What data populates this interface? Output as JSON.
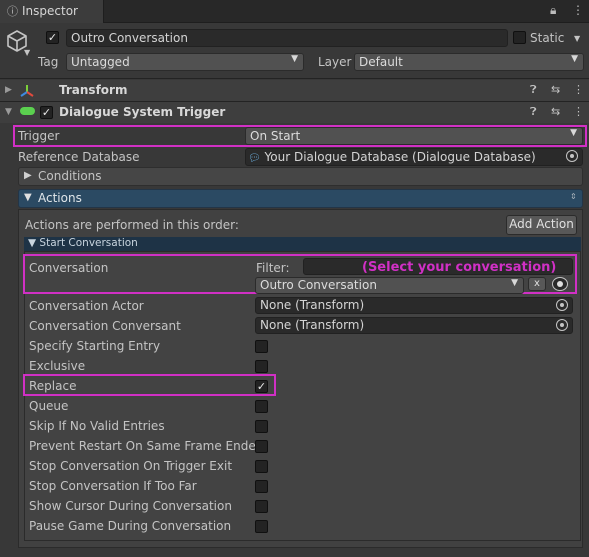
{
  "tab": {
    "label": "Inspector",
    "icon": "info-icon"
  },
  "header": {
    "object_name": "Outro Conversation",
    "static_label": "Static",
    "tag_label": "Tag",
    "tag_value": "Untagged",
    "layer_label": "Layer",
    "layer_value": "Default"
  },
  "components": {
    "transform": {
      "title": "Transform"
    },
    "dialogue_trigger": {
      "title": "Dialogue System Trigger"
    }
  },
  "trigger": {
    "label": "Trigger",
    "value": "On Start"
  },
  "reference_db": {
    "label": "Reference Database",
    "value": "Your Dialogue Database (Dialogue Database)"
  },
  "conditions": {
    "label": "Conditions"
  },
  "actions": {
    "label": "Actions",
    "order_text": "Actions are performed in this order:",
    "add_button": "Add Action"
  },
  "start_conversation": {
    "header": "Start Conversation",
    "conversation_label": "Conversation",
    "filter_label": "Filter:",
    "filter_value": "",
    "callout": "(Select your conversation)",
    "conversation_value": "Outro Conversation",
    "clear_button": "x",
    "actor_label": "Conversation Actor",
    "actor_value": "None (Transform)",
    "conversant_label": "Conversation Conversant",
    "conversant_value": "None (Transform)",
    "toggles": [
      {
        "label": "Specify Starting Entry",
        "checked": false
      },
      {
        "label": "Exclusive",
        "checked": false
      },
      {
        "label": "Replace",
        "checked": true
      },
      {
        "label": "Queue",
        "checked": false
      },
      {
        "label": "Skip If No Valid Entries",
        "checked": false
      },
      {
        "label": "Prevent Restart On Same Frame Ended",
        "checked": false
      },
      {
        "label": "Stop Conversation On Trigger Exit",
        "checked": false
      },
      {
        "label": "Stop Conversation If Too Far",
        "checked": false
      },
      {
        "label": "Show Cursor During Conversation",
        "checked": false
      },
      {
        "label": "Pause Game During Conversation",
        "checked": false
      }
    ]
  },
  "colors": {
    "highlight": "#d130c5",
    "background": "#383838",
    "section_blue": "#2b4a63"
  }
}
